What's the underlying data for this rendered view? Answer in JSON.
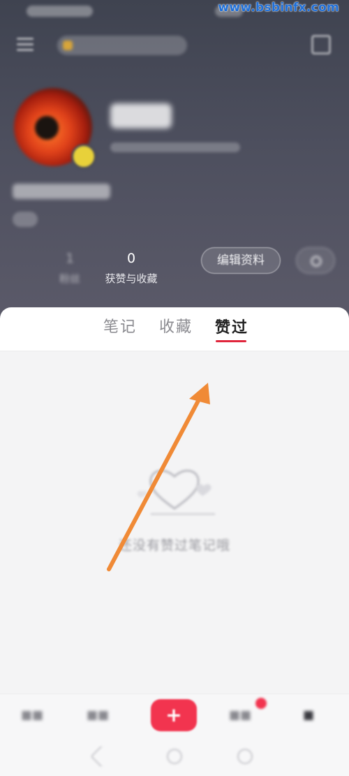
{
  "watermark": "www.bsbinfx.com",
  "profile": {
    "stats": [
      {
        "value": "",
        "label": ""
      },
      {
        "value": "1",
        "label": "粉丝"
      },
      {
        "value": "0",
        "label": "获赞与收藏"
      }
    ],
    "edit_button": "编辑资料"
  },
  "tabs": [
    {
      "label": "笔记",
      "active": false
    },
    {
      "label": "收藏",
      "active": false
    },
    {
      "label": "赞过",
      "active": true
    }
  ],
  "empty_state": {
    "text": "还没有赞过笔记哦"
  },
  "bottom_nav": {
    "plus_label": "+"
  },
  "colors": {
    "accent": "#e0263c",
    "plus_button": "#f2344f",
    "arrow": "#f08a36",
    "header_bg": "#4a4c5a"
  }
}
